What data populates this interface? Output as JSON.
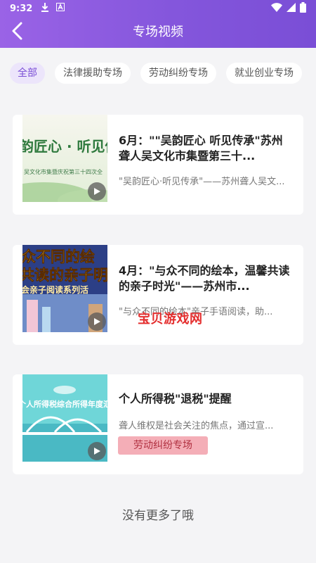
{
  "status_bar": {
    "time": "9:32",
    "icons": [
      "download-icon",
      "a-notification-icon",
      "wifi-icon",
      "signal-icon",
      "battery-icon"
    ]
  },
  "header": {
    "title": "专场视频",
    "back_icon": "chevron-left-icon",
    "gradient_start": "#9a63e6",
    "gradient_end": "#7a4ed6"
  },
  "tabs": [
    {
      "label": "全部",
      "active": true
    },
    {
      "label": "法律援助专场",
      "active": false
    },
    {
      "label": "劳动纠纷专场",
      "active": false
    },
    {
      "label": "就业创业专场",
      "active": false
    }
  ],
  "videos": [
    {
      "title": "6月：\"\"吴韵匠心 听见传承\"苏州聋人吴文化市集暨第三十...",
      "description": "\"吴韵匠心·听见传承\"——苏州聋人吴文...",
      "thumbnail": {
        "headline": "韵匠心 · 听见传",
        "subline": "吴文化市集暨庆祝第三十四次全"
      }
    },
    {
      "title": "4月：\"与众不同的绘本，温馨共读的亲子时光\"——苏州市...",
      "description": "\"与众不同的绘本\"亲子手语阅读，助...",
      "thumbnail": {
        "line1": "众不同的绘",
        "line2": "共读的亲子明",
        "line3": "会亲子阅读系列活"
      }
    },
    {
      "title": "个人所得税\"退税\"提醒",
      "description": "聋人维权是社会关注的焦点，通过宣...",
      "tag": "劳动纠纷专场",
      "thumbnail": {
        "headline": "个人所得税综合所得年度汇"
      }
    }
  ],
  "watermark": "宝贝游戏网",
  "footer": "没有更多了哦"
}
